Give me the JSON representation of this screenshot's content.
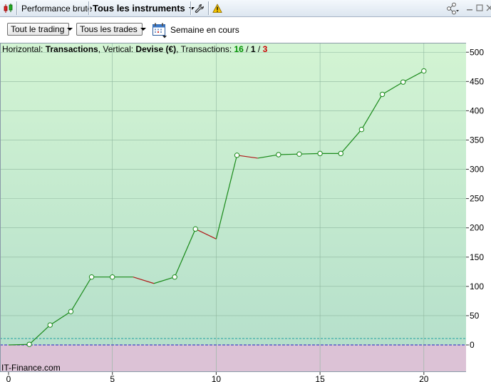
{
  "toolbar": {
    "icon": "candlestick-chart-icon",
    "performance_label": "Performance brute",
    "instruments_label": "Tous les instruments",
    "tool_icon": "wrench-icon",
    "warning_icon": "warning-icon",
    "share_icon": "share-icon"
  },
  "filters": {
    "trading_label": "Tout le trading",
    "trades_label": "Tous les trades",
    "calendar_icon": "calendar-icon",
    "period_label": "Semaine en cours"
  },
  "chart_header": {
    "prefix": "Horizontal: ",
    "horizontal": "Transactions",
    "mid": ", Vertical: ",
    "vertical": "Devise (€)",
    "tx_label": ", Transactions: ",
    "wins": "16",
    "slash1": " / ",
    "neutral": "1",
    "slash2": " / ",
    "losses": "3"
  },
  "watermark": "IT-Finance.com",
  "colors": {
    "gain_line": "#1a8a1a",
    "loss_line": "#b01818",
    "bg_top": "#d3f4d3",
    "bg_bottom": "#b6e0cb",
    "negative_zone": "#dcc2d6",
    "grid": "#8fb79f",
    "zero_line": "#2020c0",
    "threshold_line": "#20a0a0"
  },
  "chart_data": {
    "type": "line",
    "title": "",
    "xlabel": "Transactions",
    "ylabel": "Devise (€)",
    "x": [
      0,
      1,
      2,
      3,
      4,
      5,
      6,
      7,
      8,
      9,
      10,
      11,
      12,
      13,
      14,
      15,
      16,
      17,
      18,
      19,
      20
    ],
    "y": [
      0,
      1,
      34,
      57,
      116,
      116,
      116,
      105,
      116,
      198,
      181,
      324,
      319,
      325,
      326,
      327,
      327,
      368,
      428,
      449,
      468
    ],
    "markers": [
      false,
      true,
      true,
      true,
      true,
      true,
      false,
      false,
      true,
      true,
      false,
      true,
      false,
      true,
      true,
      true,
      true,
      true,
      true,
      true,
      true
    ],
    "xlim": [
      0,
      22
    ],
    "ylim": [
      -45,
      505
    ],
    "x_ticks": [
      "0",
      "5",
      "10",
      "15",
      "20"
    ],
    "x_tick_values": [
      0,
      5,
      10,
      15,
      20
    ],
    "y_ticks": [
      "500",
      "450",
      "400",
      "350",
      "300",
      "250",
      "200",
      "150",
      "100",
      "50",
      "0"
    ],
    "y_tick_values": [
      500,
      450,
      400,
      350,
      300,
      250,
      200,
      150,
      100,
      50,
      0
    ],
    "threshold": 11,
    "grid": true
  }
}
